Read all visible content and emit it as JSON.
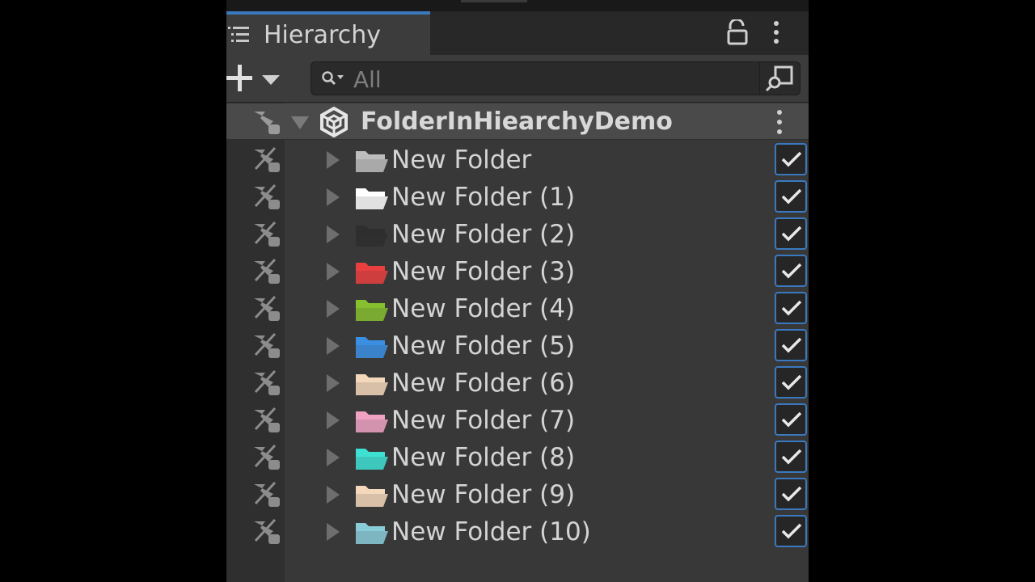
{
  "window": {
    "tab_title": "Hierarchy"
  },
  "toolbar": {
    "search_placeholder": "All"
  },
  "scene": {
    "name": "FolderInHiearchyDemo"
  },
  "items": [
    {
      "label": "New Folder",
      "folder_color": "#bdbdbd",
      "checked": true
    },
    {
      "label": "New Folder (1)",
      "folder_color": "#ffffff",
      "checked": true
    },
    {
      "label": "New Folder (2)",
      "folder_color": "#2e2e2e",
      "checked": true
    },
    {
      "label": "New Folder (3)",
      "folder_color": "#ea3f3f",
      "checked": true
    },
    {
      "label": "New Folder (4)",
      "folder_color": "#86c02f",
      "checked": true
    },
    {
      "label": "New Folder (5)",
      "folder_color": "#3b8fe3",
      "checked": true
    },
    {
      "label": "New Folder (6)",
      "folder_color": "#f4d8bc",
      "checked": true
    },
    {
      "label": "New Folder (7)",
      "folder_color": "#efa2c2",
      "checked": true
    },
    {
      "label": "New Folder (8)",
      "folder_color": "#3fe0d4",
      "checked": true
    },
    {
      "label": "New Folder (9)",
      "folder_color": "#f4d8bc",
      "checked": true
    },
    {
      "label": "New Folder (10)",
      "folder_color": "#89cdd8",
      "checked": true
    }
  ],
  "colors": {
    "accent": "#3a79c0",
    "panel_bg": "#383838",
    "selected_row": "#4a4a4a"
  },
  "icons": {
    "tab": "hierarchy-list-icon",
    "lock": "lock-icon",
    "more": "kebab-menu-icon",
    "create": "plus-icon",
    "search": "search-icon",
    "scene_search": "scene-search-icon",
    "scene": "unity-logo-icon",
    "visibility": "hidden-pickable-icon",
    "expand": "triangle-right-icon",
    "folder": "folder-icon",
    "toggle": "checkmark-icon"
  }
}
